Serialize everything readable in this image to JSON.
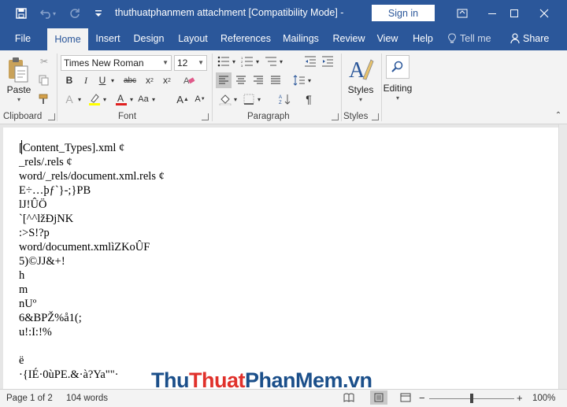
{
  "titlebar": {
    "title": "thuthuatphanmem attachment [Compatibility Mode]  -",
    "signin_label": "Sign in",
    "save_icon": "save-icon",
    "undo_icon": "undo-icon",
    "redo_icon": "redo-icon",
    "qat_icon": "customize-qat-icon"
  },
  "tabs": [
    "File",
    "Home",
    "Insert",
    "Design",
    "Layout",
    "References",
    "Mailings",
    "Review",
    "View",
    "Help"
  ],
  "tell_me": "Tell me",
  "share": "Share",
  "ribbon": {
    "paste_label": "Paste",
    "font_name": "Times New Roman",
    "font_size": "12",
    "groups": {
      "clipboard": "Clipboard",
      "font": "Font",
      "paragraph": "Paragraph",
      "styles": "Styles"
    },
    "styles_label": "Styles",
    "editing_label": "Editing"
  },
  "document": {
    "lines": [
      "[Content_Types].xml ¢",
      "_rels/.rels ¢",
      "word/_rels/document.xml.rels ¢",
      "E÷…þƒ`}-;}PB",
      "lJ!ÛÖ",
      "`[^^lžĐjNK",
      ":>S!?p",
      "word/document.xmlìZKoÛF",
      "5)©JJ&+!",
      "h",
      "m",
      "nUº",
      "6&BPŽ%å1(;",
      "u!:I:!%",
      "",
      "ë",
      "·{IÉ·0ùPE.&·à?Ya\"\"·"
    ]
  },
  "watermark": {
    "part1": "Thu",
    "part2": "Thuat",
    "part3": "PhanMem",
    "part4": ".vn",
    "color_dark": "#1b4f8a",
    "color_red": "#e0312b"
  },
  "statusbar": {
    "page": "Page 1 of 2",
    "words": "104 words",
    "zoom_minus": "−",
    "zoom_plus": "+",
    "zoom_level": "100%",
    "zoom_fraction": 0.5
  },
  "colors": {
    "accent": "#2b579a",
    "ribbon_bg": "#f3f3f3"
  }
}
